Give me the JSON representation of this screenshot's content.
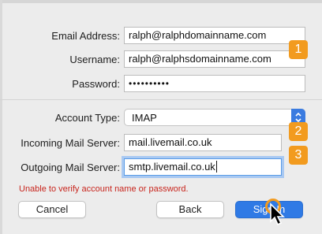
{
  "form": {
    "email": {
      "label": "Email Address:",
      "value": "ralph@ralphdomainname.com"
    },
    "username": {
      "label": "Username:",
      "value": "ralph@ralphsdomainname.com"
    },
    "password": {
      "label": "Password:",
      "value": "••••••••••"
    },
    "account_type": {
      "label": "Account Type:",
      "value": "IMAP"
    },
    "incoming": {
      "label": "Incoming Mail Server:",
      "value": "mail.livemail.co.uk"
    },
    "outgoing": {
      "label": "Outgoing Mail Server:",
      "value": "smtp.livemail.co.uk"
    }
  },
  "badges": {
    "one": "1",
    "two": "2",
    "three": "3"
  },
  "error": "Unable to verify account name or password.",
  "buttons": {
    "cancel": "Cancel",
    "back": "Back",
    "sign_in": "Sign In"
  },
  "colors": {
    "accent": "#2f7ae5",
    "badge": "#f29b1f",
    "error": "#c8251d",
    "focus_ring": "#a9c9f2"
  },
  "icons": {
    "select_chevron": "chevron-up-down-icon",
    "pointer": "arrow-cursor-icon"
  }
}
